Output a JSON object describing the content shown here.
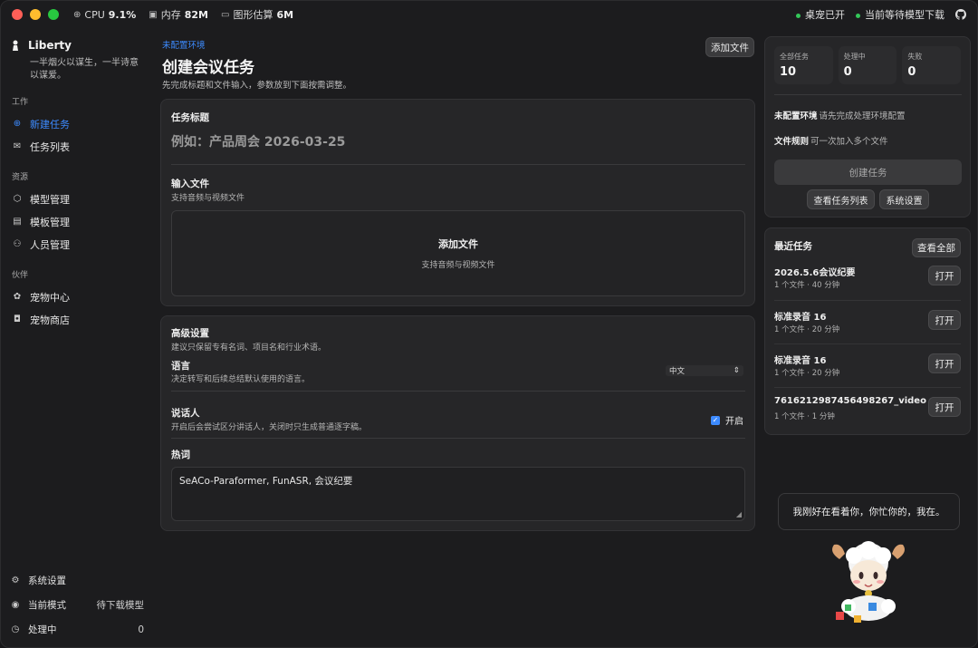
{
  "titlebar": {
    "cpu_label": "CPU",
    "cpu_value": "9.1%",
    "mem_label": "内存",
    "mem_value": "82M",
    "gpu_label": "图形估算",
    "gpu_value": "6M",
    "pet_status": "桌宠已开",
    "model_status": "当前等待模型下载"
  },
  "sidebar": {
    "brand": "Liberty",
    "motto": "一半烟火以谋生，一半诗意以谋爱。",
    "sections": [
      {
        "label": "工作",
        "items": [
          {
            "label": "新建任务",
            "icon": "plus-circle-icon",
            "active": true
          },
          {
            "label": "任务列表",
            "icon": "inbox-icon"
          }
        ]
      },
      {
        "label": "资源",
        "items": [
          {
            "label": "模型管理",
            "icon": "cube-icon"
          },
          {
            "label": "模板管理",
            "icon": "document-icon"
          },
          {
            "label": "人员管理",
            "icon": "people-icon"
          }
        ]
      },
      {
        "label": "伙伴",
        "items": [
          {
            "label": "宠物中心",
            "icon": "paw-icon"
          },
          {
            "label": "宠物商店",
            "icon": "bag-icon"
          }
        ]
      }
    ],
    "bottom": {
      "settings": "系统设置",
      "mode_label": "当前模式",
      "mode_value": "待下载模型",
      "processing_label": "处理中",
      "processing_value": "0"
    }
  },
  "main": {
    "breadcrumb": "未配置环境",
    "title": "创建会议任务",
    "subtitle": "先完成标题和文件输入，参数放到下面按需调整。",
    "add_file_button": "添加文件",
    "task_title_label": "任务标题",
    "task_title_placeholder": "例如：产品周会 2026-03-25",
    "input_files_label": "输入文件",
    "input_files_hint": "支持音频与视频文件",
    "dropzone_title": "添加文件",
    "dropzone_hint": "支持音频与视频文件",
    "advanced": {
      "title": "高级设置",
      "hint": "建议只保留专有名词、项目名和行业术语。",
      "language_label": "语言",
      "language_hint": "决定转写和后续总结默认使用的语言。",
      "language_value": "中文",
      "speaker_label": "说话人",
      "speaker_hint": "开启后会尝试区分讲话人，关闭时只生成普通逐字稿。",
      "speaker_toggle": "开启",
      "hotwords_label": "热词",
      "hotwords_value": "SeACo-Paraformer, FunASR, 会议纪要"
    }
  },
  "summary": {
    "stats": [
      {
        "label": "全部任务",
        "value": "10"
      },
      {
        "label": "处理中",
        "value": "0"
      },
      {
        "label": "失败",
        "value": "0"
      }
    ],
    "env_label": "未配置环境",
    "env_text": "请先完成处理环境配置",
    "rule_label": "文件规则",
    "rule_text": "可一次加入多个文件",
    "create_button": "创建任务",
    "view_list_button": "查看任务列表",
    "settings_button": "系统设置"
  },
  "recent": {
    "title": "最近任务",
    "view_all": "查看全部",
    "open_label": "打开",
    "items": [
      {
        "name": "2026.5.6会议纪要",
        "meta": "1 个文件 · 40 分钟"
      },
      {
        "name": "标准录音 16",
        "meta": "1 个文件 · 20 分钟"
      },
      {
        "name": "标准录音 16",
        "meta": "1 个文件 · 20 分钟"
      },
      {
        "name": "7616212987456498267_video",
        "meta": "1 个文件 · 1 分钟"
      }
    ]
  },
  "pet": {
    "bubble": "我刚好在看着你，你忙你的，我在。"
  }
}
